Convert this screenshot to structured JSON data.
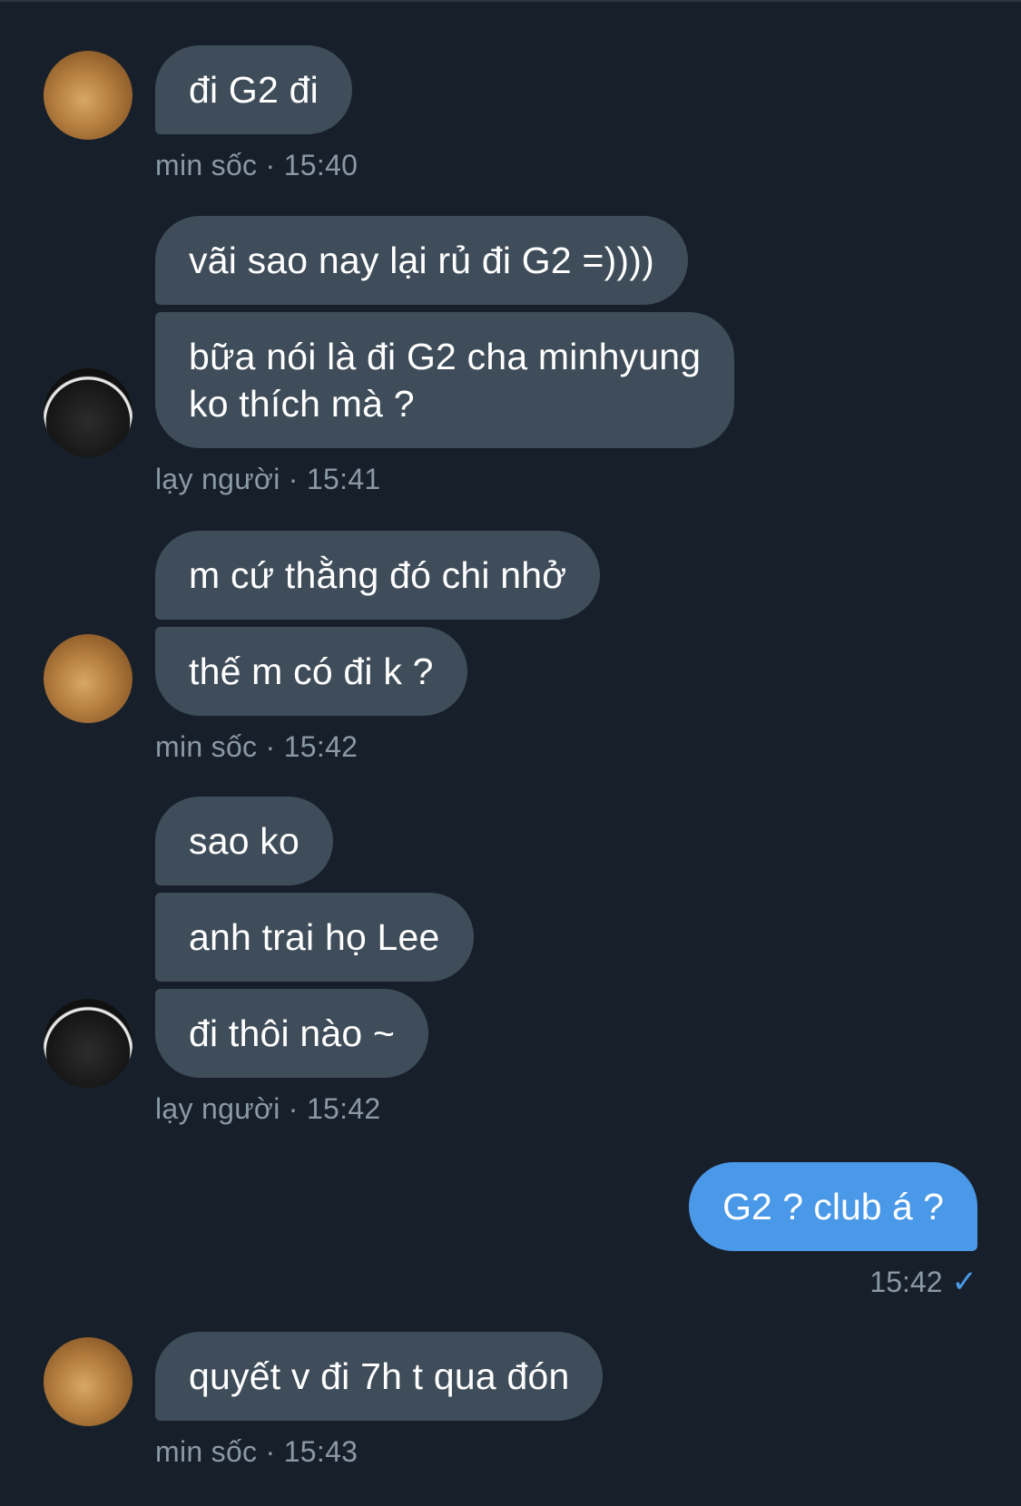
{
  "messages": [
    {
      "sender": "min sốc",
      "time": "15:40",
      "avatar": "orange-cat-glasses-avatar",
      "bubbles": [
        "đi G2 đi"
      ]
    },
    {
      "sender": "lạy người",
      "time": "15:41",
      "avatar": "praying-person-avatar",
      "bubbles": [
        "vãi sao nay lại rủ đi G2 =))))",
        "bữa nói là đi G2 cha minhyung",
        "ko thích mà ?"
      ]
    },
    {
      "sender": "min sốc",
      "time": "15:42",
      "avatar": "orange-cat-glasses-avatar",
      "bubbles": [
        "m cứ thằng đó chi nhở",
        "thế m có đi k ?"
      ]
    },
    {
      "sender": "lạy người",
      "time": "15:42",
      "avatar": "praying-person-avatar",
      "bubbles": [
        "sao ko",
        "anh trai họ Lee",
        "đi thôi nào ~"
      ]
    },
    {
      "sender": "",
      "time": "15:42",
      "own": true,
      "bubbles": [
        "G2 ? club á ?"
      ],
      "read_icon": "checkmark-icon"
    },
    {
      "sender": "min sốc",
      "time": "15:43",
      "avatar": "orange-cat-glasses-avatar",
      "bubbles": [
        "quyết v đi 7h t qua đón"
      ]
    }
  ],
  "meta_separator": " · ",
  "check_glyph": "✓",
  "colors": {
    "background": "#17202a",
    "incoming_bubble": "#3f4d5a",
    "outgoing_bubble": "#4a99e9",
    "meta_text": "#8b98a5"
  }
}
